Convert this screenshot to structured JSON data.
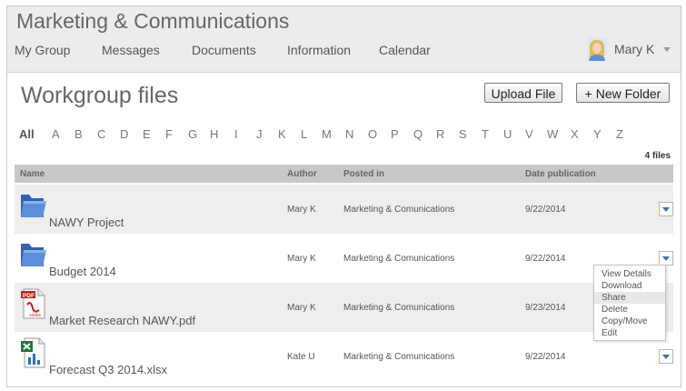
{
  "app": {
    "title": "Marketing & Communications"
  },
  "nav": [
    {
      "label": "My Group"
    },
    {
      "label": "Messages"
    },
    {
      "label": "Documents"
    },
    {
      "label": "Information"
    },
    {
      "label": "Calendar"
    }
  ],
  "user": {
    "name": "Mary K"
  },
  "page": {
    "title": "Workgroup files"
  },
  "toolbar": {
    "upload_label": "Upload File",
    "new_folder_label": "+ New Folder"
  },
  "alphabet": [
    "All",
    "A",
    "B",
    "C",
    "D",
    "E",
    "F",
    "G",
    "H",
    "I",
    "J",
    "K",
    "L",
    "M",
    "N",
    "O",
    "P",
    "Q",
    "R",
    "S",
    "T",
    "U",
    "V",
    "W",
    "X",
    "Y",
    "Z"
  ],
  "file_count": "4 files",
  "table": {
    "columns": [
      "Name",
      "Author",
      "Posted in",
      "Date publication"
    ],
    "rows": [
      {
        "icon": "folder-icon",
        "name": "NAWY Project",
        "author": "Mary K",
        "posted_in": "Marketing & Comunications",
        "date": "9/22/2014"
      },
      {
        "icon": "folder-icon",
        "name": "Budget 2014",
        "author": "Mary K",
        "posted_in": "Marketing & Comunications",
        "date": "9/22/2014"
      },
      {
        "icon": "pdf-file-icon",
        "name": "Market Research NAWY.pdf",
        "author": "Mary K",
        "posted_in": "Marketing & Comunications",
        "date": "9/23/2014"
      },
      {
        "icon": "excel-file-icon",
        "name": "Forecast Q3 2014.xlsx",
        "author": "Kate U",
        "posted_in": "Marketing & Comunications",
        "date": "9/22/2014"
      }
    ]
  },
  "row_menu": {
    "items": [
      "View Details",
      "Download",
      "Share",
      "Delete",
      "Copy/Move",
      "Edit"
    ],
    "highlighted": "Share"
  },
  "colors": {
    "header_bg": "#ececec",
    "table_header_bg": "#c8c8c8",
    "alt_row_bg": "#eeeeee",
    "accent_blue": "#3a6fb3"
  }
}
